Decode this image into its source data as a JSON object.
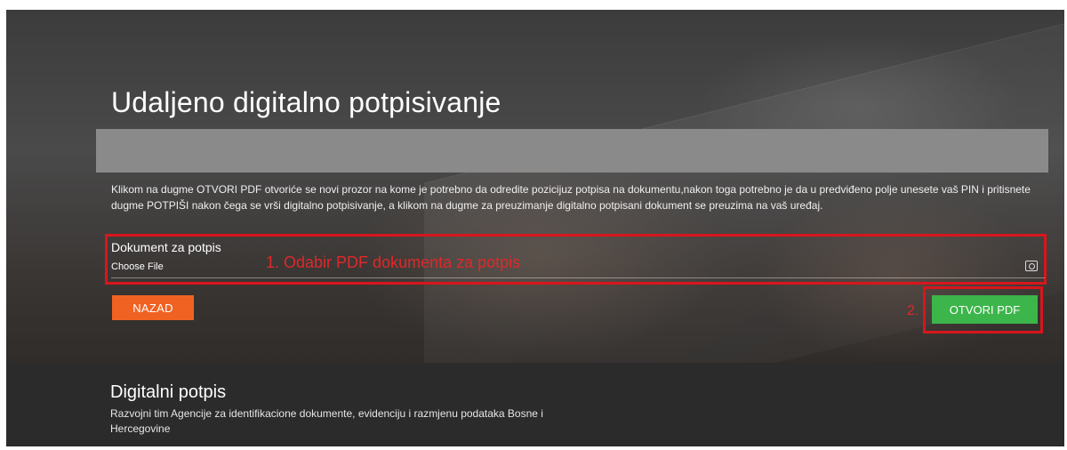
{
  "page": {
    "title": "Udaljeno digitalno potpisivanje",
    "instructions": "Klikom na dugme OTVORI PDF otvoriće se novi prozor na kome je potrebno da odredite pozicijuz potpisa na dokumentu,nakon toga potrebno je da u predviđeno polje unesete vaš PIN i pritisnete dugme POTPIŠI nakon čega se vrši digitalno potpisivanje, a klikom na dugme za preuzimanje digitalno potpisani dokument se preuzima na vaš uređaj."
  },
  "document_field": {
    "label": "Dokument za potpis",
    "button_text": "Choose File",
    "icon": "file-browse-icon"
  },
  "annotations": {
    "step1": "1. Odabir PDF dokumenta za potpis",
    "step2": "2."
  },
  "buttons": {
    "back": "NAZAD",
    "open_pdf": "OTVORI PDF"
  },
  "footer": {
    "title": "Digitalni potpis",
    "text": "Razvojni tim Agencije za identifikacione dokumente, evidenciju i razmjenu podataka Bosne i Hercegovine"
  },
  "colors": {
    "back_button": "#f06222",
    "open_button": "#3cb54a",
    "annotation": "#d8161c",
    "footer_bg": "#2b2b2b"
  }
}
